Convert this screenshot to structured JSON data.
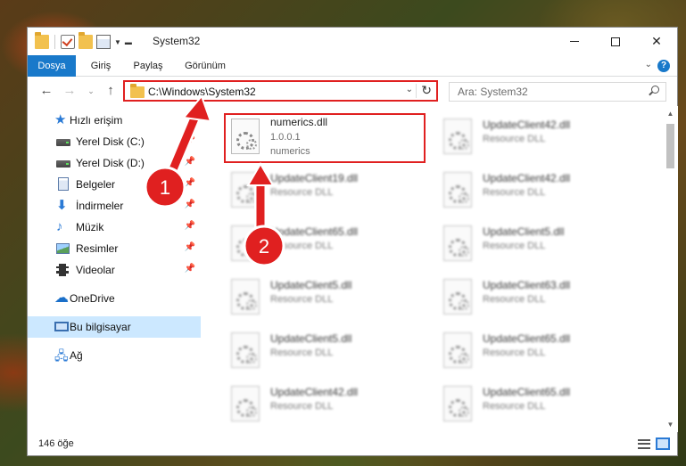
{
  "window": {
    "title": "System32",
    "ribbon_tabs": [
      "Dosya",
      "Giriş",
      "Paylaş",
      "Görünüm"
    ]
  },
  "nav": {
    "address": "C:\\Windows\\System32",
    "search_placeholder": "Ara: System32"
  },
  "sidebar": {
    "items": [
      {
        "label": "Hızlı erişim",
        "icon": "star-icon"
      },
      {
        "label": "Yerel Disk (C:)",
        "icon": "drive-icon"
      },
      {
        "label": "Yerel Disk (D:)",
        "icon": "drive-icon"
      },
      {
        "label": "Belgeler",
        "icon": "documents-icon"
      },
      {
        "label": "İndirmeler",
        "icon": "download-icon"
      },
      {
        "label": "Müzik",
        "icon": "music-icon"
      },
      {
        "label": "Resimler",
        "icon": "pictures-icon"
      },
      {
        "label": "Videolar",
        "icon": "videos-icon"
      },
      {
        "label": "OneDrive",
        "icon": "cloud-icon"
      },
      {
        "label": "Bu bilgisayar",
        "icon": "computer-icon"
      },
      {
        "label": "Ağ",
        "icon": "network-icon"
      }
    ]
  },
  "files": [
    {
      "name": "numerics.dll",
      "line2": "1.0.0.1",
      "line3": "numerics",
      "highlighted": true
    },
    {
      "name": "UpdateClient42.dll",
      "line2": "Resource DLL"
    },
    {
      "name": "UpdateClient19.dll",
      "line2": "Resource DLL"
    },
    {
      "name": "UpdateClient42.dll",
      "line2": "Resource DLL"
    },
    {
      "name": "UpdateClient65.dll",
      "line2": "Resource DLL"
    },
    {
      "name": "UpdateClient5.dll",
      "line2": "Resource DLL"
    },
    {
      "name": "UpdateClient5.dll",
      "line2": "Resource DLL"
    },
    {
      "name": "UpdateClient63.dll",
      "line2": "Resource DLL"
    },
    {
      "name": "UpdateClient5.dll",
      "line2": "Resource DLL"
    },
    {
      "name": "UpdateClient65.dll",
      "line2": "Resource DLL"
    },
    {
      "name": "UpdateClient42.dll",
      "line2": "Resource DLL"
    },
    {
      "name": "UpdateClient65.dll",
      "line2": "Resource DLL"
    }
  ],
  "status": {
    "item_count": "146 öğe"
  },
  "annotations": {
    "badge_1": "1",
    "badge_2": "2",
    "highlight_color": "#e02020"
  }
}
